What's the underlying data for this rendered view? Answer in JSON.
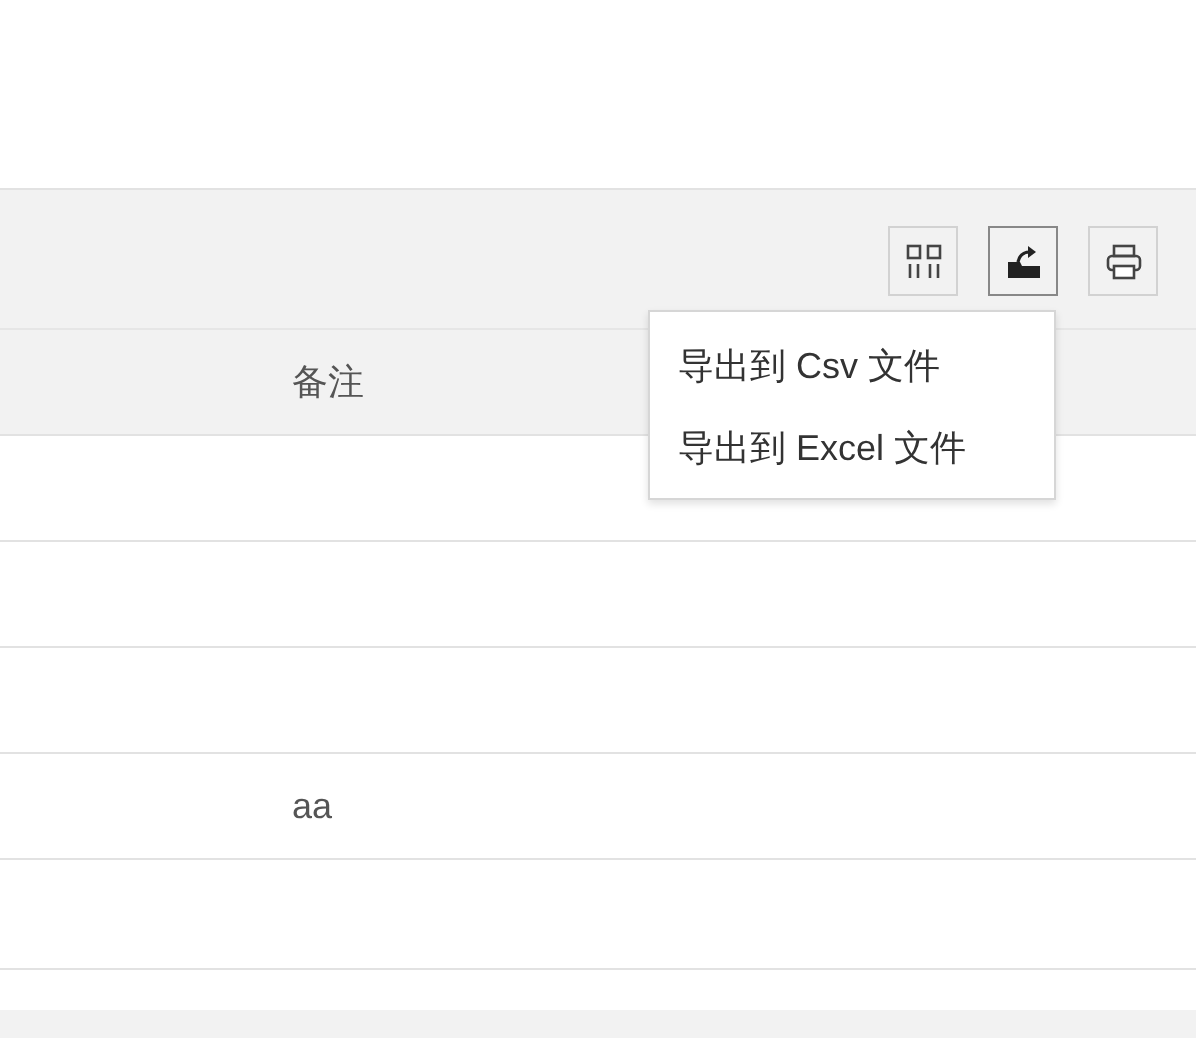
{
  "toolbar": {
    "buttons": [
      {
        "kind": "columns",
        "selected": false
      },
      {
        "kind": "export",
        "selected": true
      },
      {
        "kind": "print",
        "selected": false
      }
    ]
  },
  "export_menu": {
    "items": [
      "导出到 Csv 文件",
      "导出到 Excel 文件"
    ]
  },
  "table": {
    "columns": [
      "备注"
    ],
    "rows": [
      {
        "note": ""
      },
      {
        "note": ""
      },
      {
        "note": ""
      },
      {
        "note": "aa"
      },
      {
        "note": ""
      }
    ]
  }
}
